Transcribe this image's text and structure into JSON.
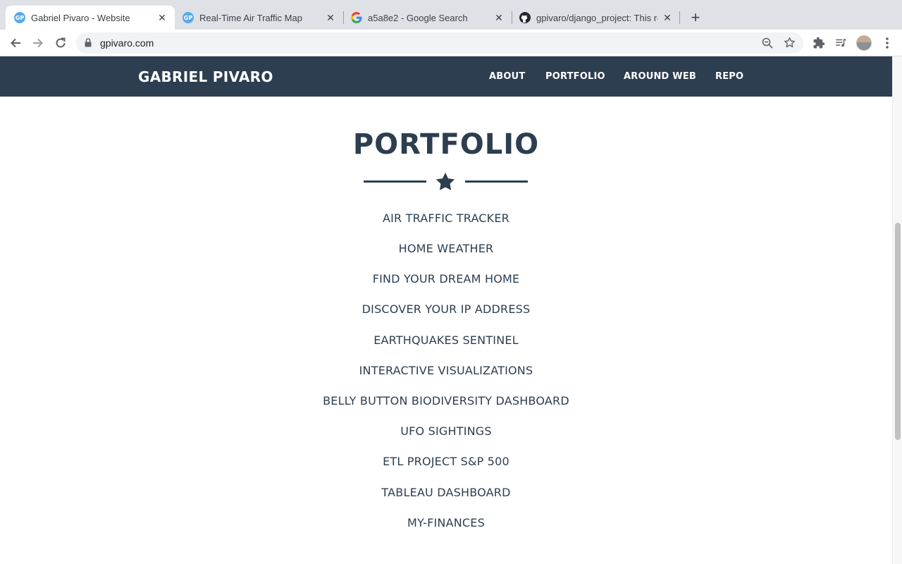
{
  "browser": {
    "tabs": [
      {
        "title": "Gabriel Pivaro - Website",
        "favicon": "gp-favicon",
        "active": true
      },
      {
        "title": "Real-Time Air Traffic Map",
        "favicon": "gp-favicon",
        "active": false
      },
      {
        "title": "a5a8e2 - Google Search",
        "favicon": "google-icon",
        "active": false
      },
      {
        "title": "gpivaro/django_project: This re",
        "favicon": "github-icon",
        "active": false
      }
    ],
    "favicon_text": "GP",
    "close_glyph": "✕",
    "new_tab_glyph": "+",
    "url": "gpivaro.com"
  },
  "site": {
    "brand": "GABRIEL PIVARO",
    "nav": [
      "ABOUT",
      "PORTFOLIO",
      "AROUND WEB",
      "REPO"
    ],
    "section_title": "PORTFOLIO",
    "projects": [
      "AIR TRAFFIC TRACKER",
      "HOME WEATHER",
      "FIND YOUR DREAM HOME",
      "DISCOVER YOUR IP ADDRESS",
      "EARTHQUAKES SENTINEL",
      "INTERACTIVE VISUALIZATIONS",
      "BELLY BUTTON BIODIVERSITY DASHBOARD",
      "UFO SIGHTINGS",
      "ETL PROJECT S&P 500",
      "TABLEAU DASHBOARD",
      "MY-FINANCES"
    ]
  },
  "colors": {
    "navbar": "#2c3e50",
    "text": "#2c3e50",
    "tabstrip": "#dee1e6"
  }
}
